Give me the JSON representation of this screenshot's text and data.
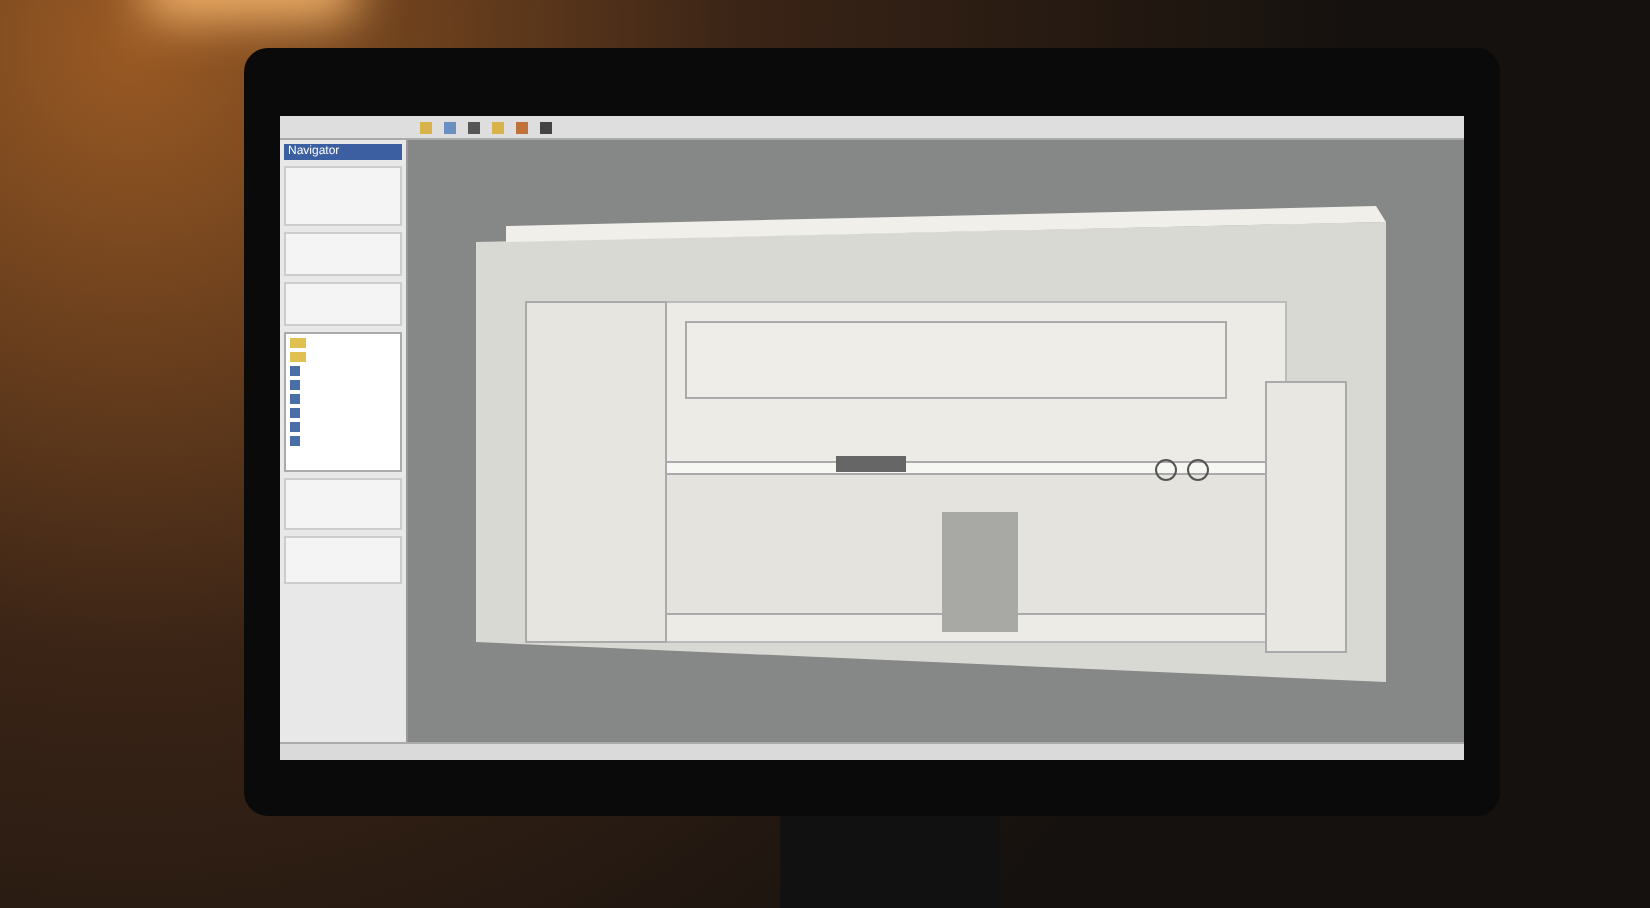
{
  "panel": {
    "title": "Navigator"
  },
  "tree": {
    "items": [
      {
        "kind": "folder"
      },
      {
        "kind": "folder"
      },
      {
        "kind": "item"
      },
      {
        "kind": "item"
      },
      {
        "kind": "item"
      },
      {
        "kind": "item"
      },
      {
        "kind": "item"
      },
      {
        "kind": "item"
      }
    ]
  }
}
